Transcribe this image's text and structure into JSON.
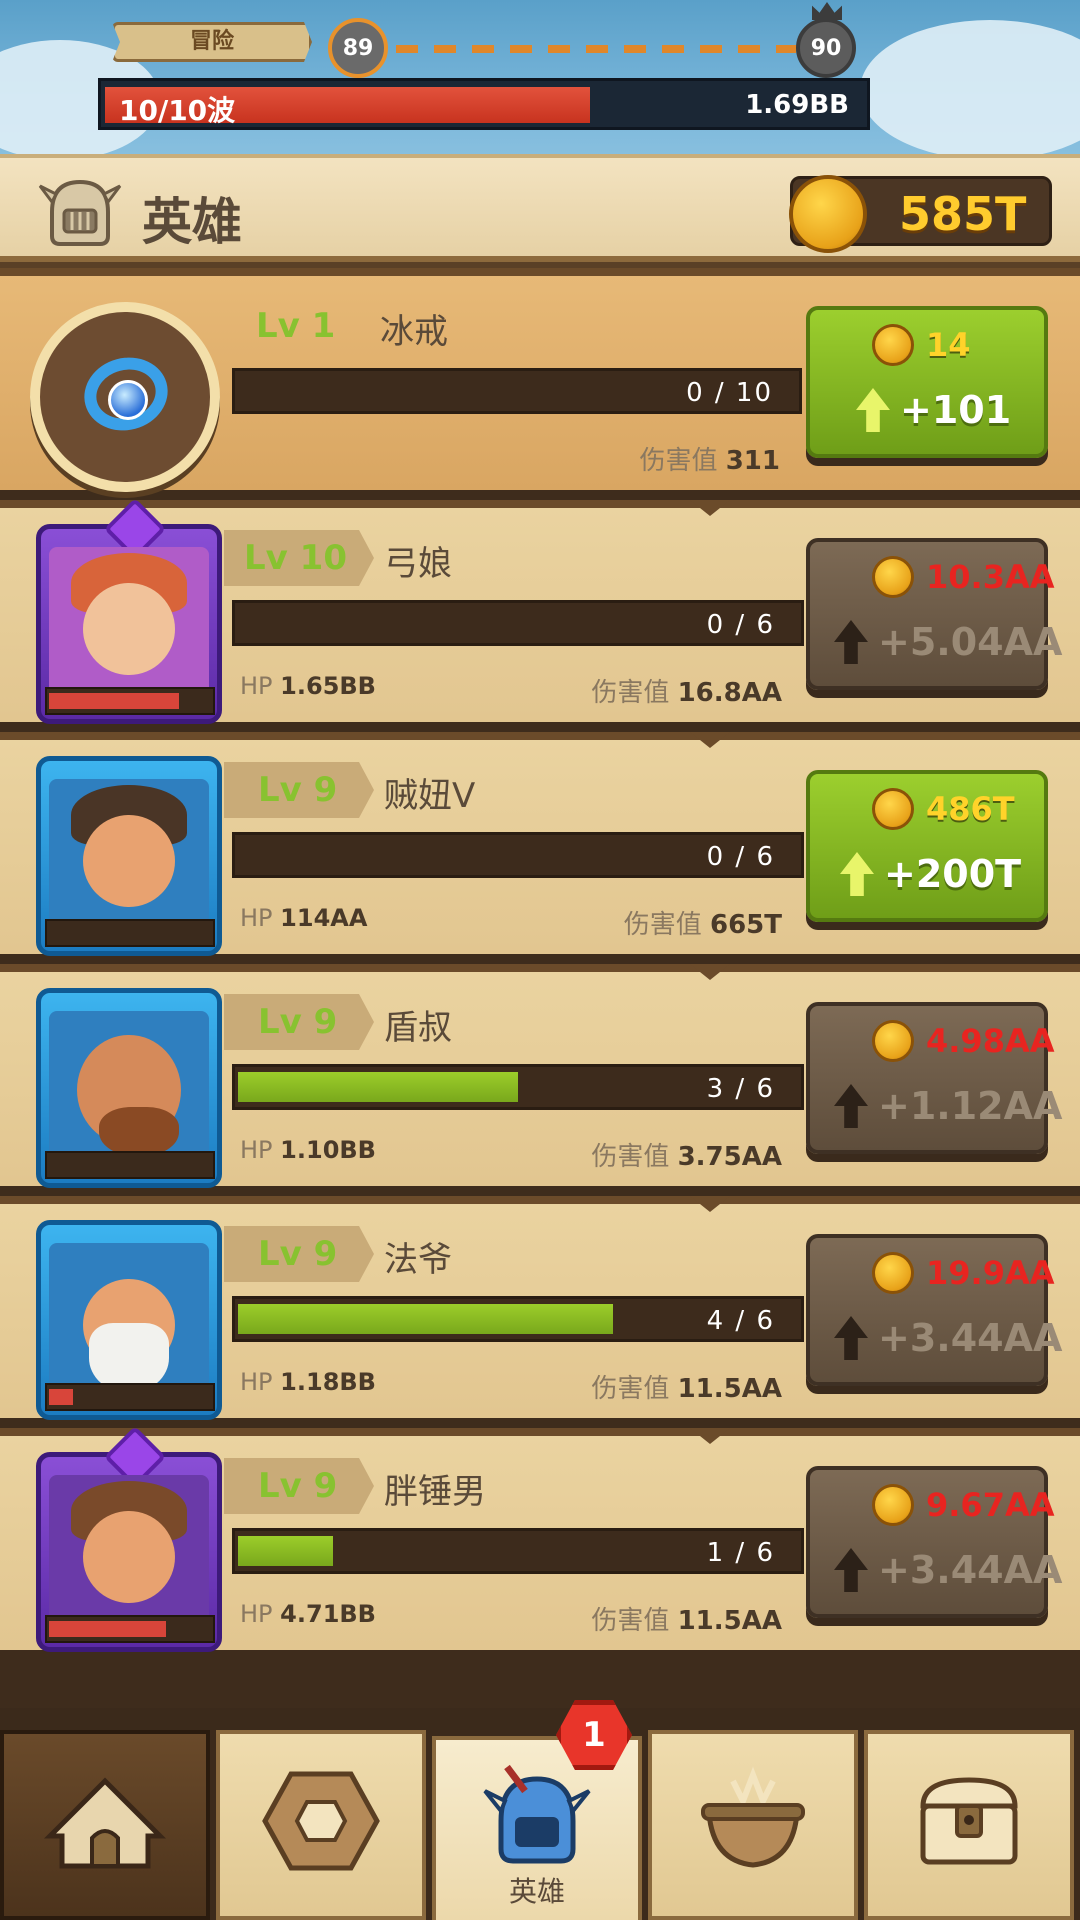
{
  "hud": {
    "mode_label": "冒险",
    "current_stage": "89",
    "boss_stage": "90",
    "wave_text": "10/10波",
    "wave_hp": "1.69BB",
    "wave_progress": 0.64
  },
  "header": {
    "title": "英雄",
    "gold": "585T"
  },
  "heroes": [
    {
      "lv_label": "Lv",
      "lv": "1",
      "name": "冰戒",
      "xp": "0 / 10",
      "xp_fraction": 0,
      "hp_label": "",
      "hp": "",
      "dmg_label": "伤害值",
      "dmg": "311",
      "cost": "14",
      "gain": "+101",
      "affordable": true,
      "hp_fraction": 0
    },
    {
      "lv_label": "Lv",
      "lv": "10",
      "name": "弓娘",
      "xp": "0 / 6",
      "xp_fraction": 0,
      "hp_label": "HP",
      "hp": "1.65BB",
      "dmg_label": "伤害值",
      "dmg": "16.8AA",
      "cost": "10.3AA",
      "gain": "+5.04AA",
      "affordable": false,
      "hp_fraction": 0.8
    },
    {
      "lv_label": "Lv",
      "lv": "9",
      "name": "贼妞V",
      "xp": "0 / 6",
      "xp_fraction": 0,
      "hp_label": "HP",
      "hp": "114AA",
      "dmg_label": "伤害值",
      "dmg": "665T",
      "cost": "486T",
      "gain": "+200T",
      "affordable": true,
      "hp_fraction": 0
    },
    {
      "lv_label": "Lv",
      "lv": "9",
      "name": "盾叔",
      "xp": "3 / 6",
      "xp_fraction": 0.5,
      "hp_label": "HP",
      "hp": "1.10BB",
      "dmg_label": "伤害值",
      "dmg": "3.75AA",
      "cost": "4.98AA",
      "gain": "+1.12AA",
      "affordable": false,
      "hp_fraction": 0
    },
    {
      "lv_label": "Lv",
      "lv": "9",
      "name": "法爷",
      "xp": "4 / 6",
      "xp_fraction": 0.67,
      "hp_label": "HP",
      "hp": "1.18BB",
      "dmg_label": "伤害值",
      "dmg": "11.5AA",
      "cost": "19.9AA",
      "gain": "+3.44AA",
      "affordable": false,
      "hp_fraction": 0.15
    },
    {
      "lv_label": "Lv",
      "lv": "9",
      "name": "胖锤男",
      "xp": "1 / 6",
      "xp_fraction": 0.17,
      "hp_label": "HP",
      "hp": "4.71BB",
      "dmg_label": "伤害值",
      "dmg": "11.5AA",
      "cost": "9.67AA",
      "gain": "+3.44AA",
      "affordable": false,
      "hp_fraction": 0.72
    }
  ],
  "nav": {
    "active_label": "英雄",
    "badge_count": "1"
  }
}
